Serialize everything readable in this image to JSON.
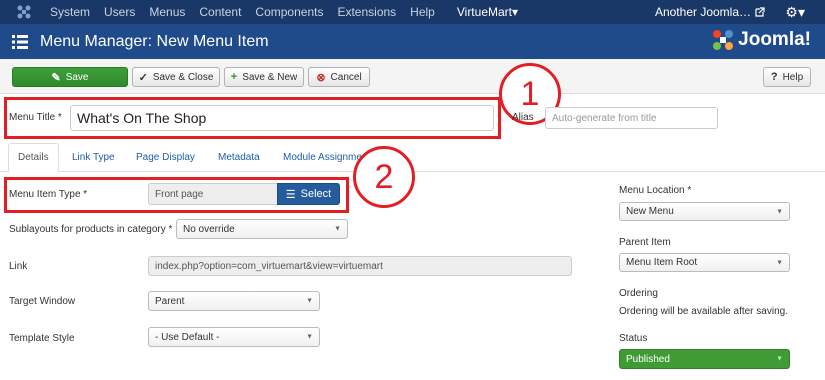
{
  "topnav": {
    "items": [
      "System",
      "Users",
      "Menus",
      "Content",
      "Components",
      "Extensions",
      "Help"
    ],
    "virtuemart": "VirtueMart",
    "virtuemart_caret": "▾",
    "site": "Another Joomla…",
    "site_icon": "external-link-icon",
    "settings_icon": "gear-icon"
  },
  "header": {
    "title": "Menu Manager: New Menu Item",
    "brand": "Joomla!"
  },
  "toolbar": {
    "save": "Save",
    "save_close": "Save & Close",
    "save_new": "Save & New",
    "cancel": "Cancel",
    "help": "Help"
  },
  "form": {
    "menu_title_label": "Menu Title *",
    "menu_title_value": "What's On The Shop",
    "alias_label": "Alias",
    "alias_placeholder": "Auto-generate from title"
  },
  "tabs": [
    "Details",
    "Link Type",
    "Page Display",
    "Metadata",
    "Module Assignment"
  ],
  "details": {
    "menu_item_type_label": "Menu Item Type *",
    "menu_item_type_value": "Front page",
    "select_label": "Select",
    "sublayouts_label": "Sublayouts for products in category *",
    "sublayouts_value": "No override",
    "link_label": "Link",
    "link_value": "index.php?option=com_virtuemart&view=virtuemart",
    "target_label": "Target Window",
    "target_value": "Parent",
    "template_label": "Template Style",
    "template_value": "- Use Default -"
  },
  "sidebar": {
    "location_label": "Menu Location *",
    "location_value": "New Menu",
    "parent_label": "Parent Item",
    "parent_value": "Menu Item Root",
    "ordering_label": "Ordering",
    "ordering_note": "Ordering will be available after saving.",
    "status_label": "Status",
    "status_value": "Published"
  },
  "annotations": [
    "1",
    "2"
  ],
  "colors": {
    "topnav": "#1a3867",
    "header": "#1f4b8b",
    "highlight": "#e31e24",
    "save_button": "#3e9f3a",
    "published": "#3f9c35"
  }
}
